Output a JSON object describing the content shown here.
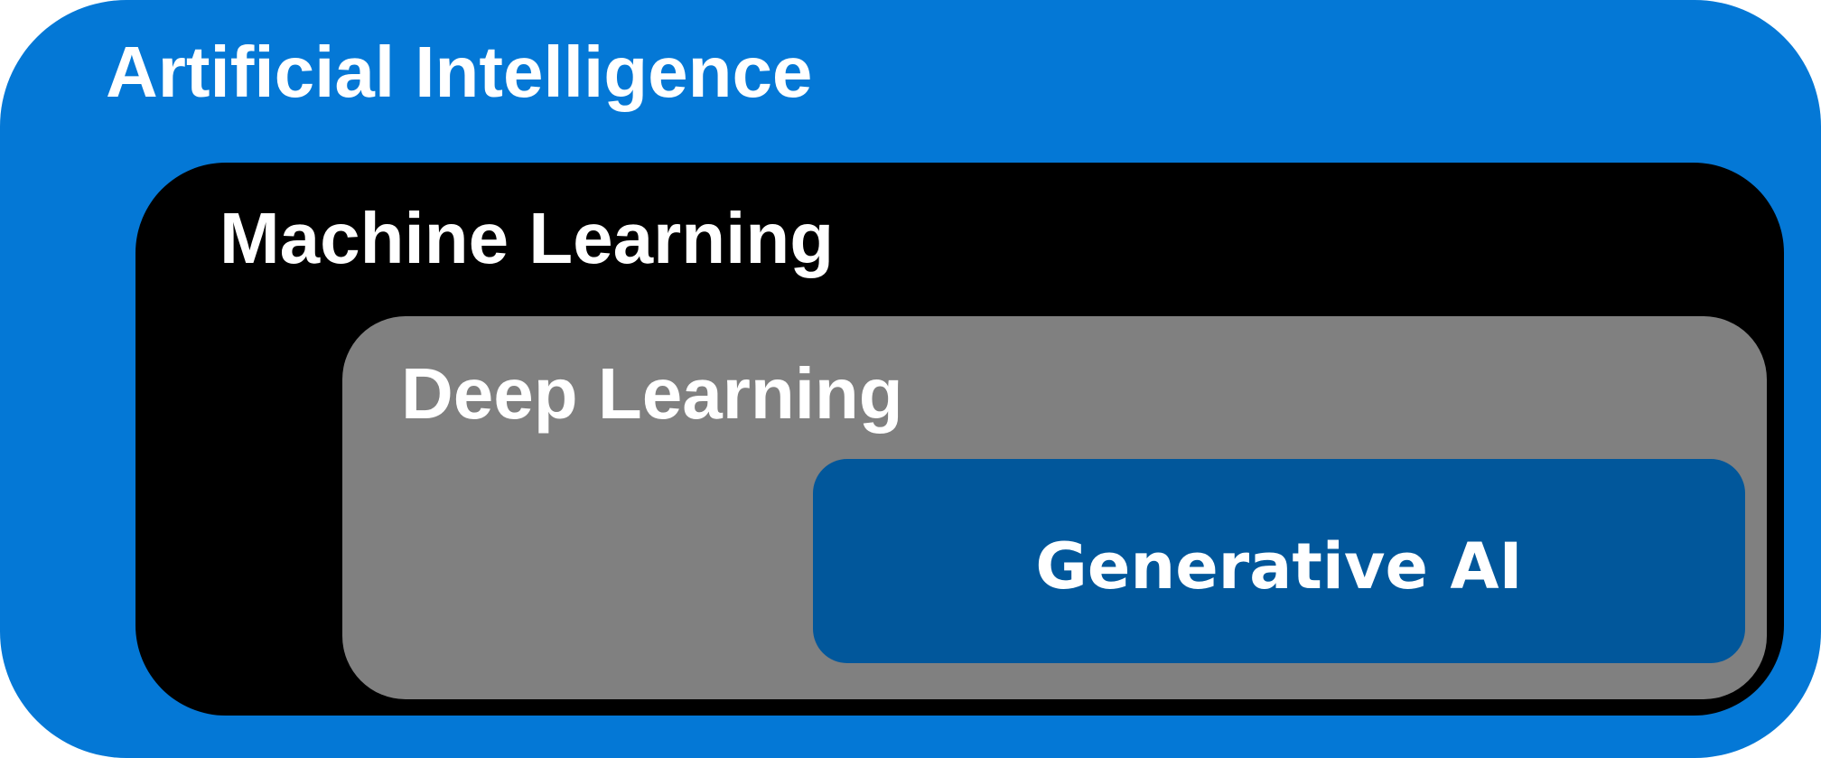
{
  "diagram": {
    "layers": [
      {
        "id": "ai",
        "label": "Artificial Intelligence",
        "color": "#0478d6"
      },
      {
        "id": "ml",
        "label": "Machine Learning",
        "color": "#000000"
      },
      {
        "id": "dl",
        "label": "Deep Learning",
        "color": "#808080"
      },
      {
        "id": "gen",
        "label": "Generative AI",
        "color": "#01579b"
      }
    ],
    "text_color": "#ffffff"
  }
}
